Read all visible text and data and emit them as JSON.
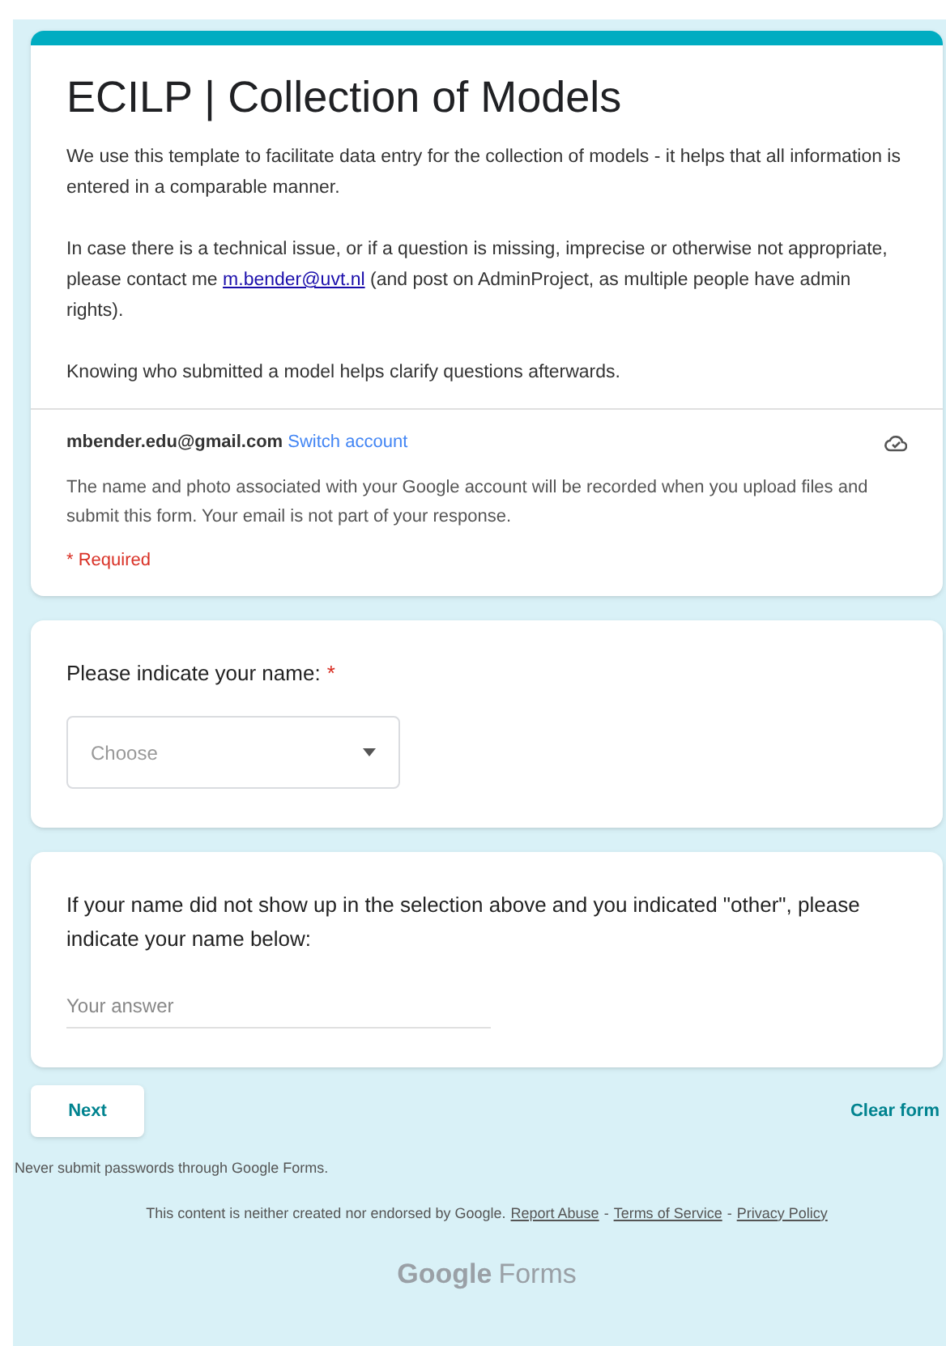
{
  "form": {
    "title": "ECILP | Collection of Models",
    "description": [
      {
        "kind": "text",
        "text": "We use this template to facilitate data entry for the collection of models - it helps that all information is entered in a comparable manner."
      },
      {
        "kind": "link_text",
        "before": "In case there is a technical issue, or if a question is missing, imprecise or otherwise not appropriate, please contact me",
        "link": "m.bender@uvt.nl",
        "after": "(and post on AdminProject, as multiple people have admin rights)."
      },
      {
        "kind": "text",
        "text": "Knowing who submitted a model helps clarify questions afterwards."
      }
    ],
    "account": {
      "email": "mbender.edu@gmail.com",
      "switch": "Switch account",
      "notice": "The name and photo associated with your Google account will be recorded when you upload files and submit this form. Your email is not part of your response."
    },
    "required_note": "* Required"
  },
  "required_mark": "*",
  "link_separator": "-",
  "questions": [
    {
      "kind": "dropdown",
      "label": "Please indicate your name:",
      "required": true,
      "placeholder": "Choose"
    },
    {
      "kind": "text",
      "label": "If your name did not show up in the selection above and you indicated \"other\", please indicate your name below:",
      "required": false,
      "placeholder": "Your answer"
    }
  ],
  "next_button": "Next",
  "clear_button": "Clear form",
  "footer": {
    "warning": "Never submit passwords through Google Forms.",
    "disclaimer": "This content is neither created nor endorsed by Google.",
    "links": [
      "Report Abuse",
      "Terms of Service",
      "Privacy Policy"
    ],
    "logo": [
      "Google",
      "Forms"
    ]
  }
}
